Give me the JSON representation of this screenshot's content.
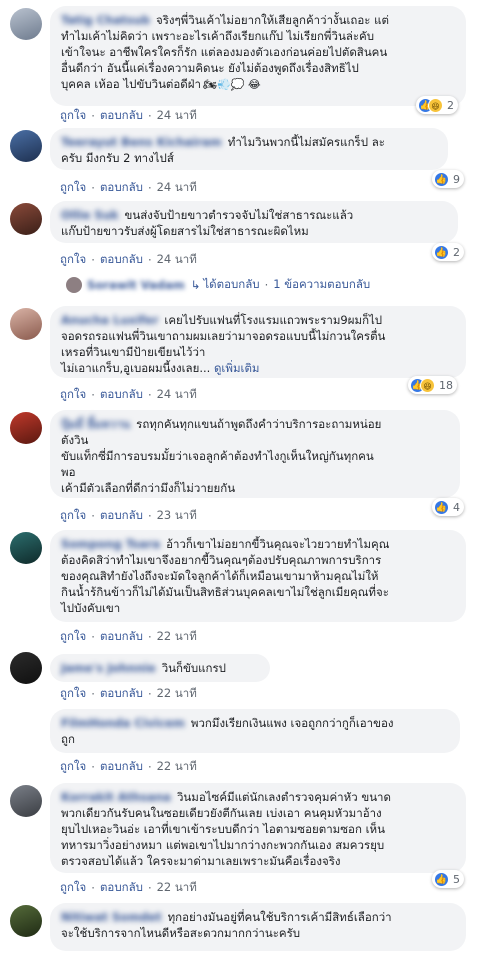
{
  "actions": {
    "like": "ถูกใจ",
    "reply": "ตอบกลับ"
  },
  "comments": [
    {
      "name": "Tatig Chatsub",
      "text": "จริงๆพี่วินเค้าไม่อยากให้เสียลูกค้าว่างั้นเถอะ แต่\nทำไมเค้าไม่คิดว่า เพราะอะไรเค้าถึงเรียกแก๊ป ไม่เรียกพี่วินล่ะคับ\nเข้าใจนะ อาชีพใครใครก็รัก แต่ลองมองตัวเองก่อนค่อยไปตัดสินคน\nอื่นดีกว่า อันนี้แค่เรื่องความคิดนะ ยังไม่ต้องพูดถึงเรื่องสิทธิไป\nบุคคล เห้ออ ไปขับวินต่อดีฝ่า",
      "emoji": "🏍💨💭 😂",
      "time": "24 นาที",
      "reaction_count": "2",
      "reactions": [
        "like",
        "haha"
      ]
    },
    {
      "name": "Teerayut Bens Kichairam",
      "text": "ทำไมวินพวกนี้ไม่สมัครแกร็ป ละ\nครับ มีงกรับ 2 ทางไปส์",
      "time": "24 นาที",
      "reaction_count": "9",
      "reactions": [
        "like"
      ]
    },
    {
      "name": "Ollie Suk",
      "text": "ขนส่งจับป้ายขาวตำรวจจับไม่ใช่สาธารณะแล้ว\nแก๊บป้ายขาวรับส่งผู้โดยสารไม่ใช่สาธารณะผิดไหม",
      "time": "24 นาที",
      "reaction_count": "2",
      "reactions": [
        "like"
      ],
      "reply_summary": {
        "name": "Sorawit Vadam",
        "replied": "ได้ตอบกลับ",
        "count": "1 ข้อความตอบกลับ"
      }
    },
    {
      "name": "Anucha Luxifer",
      "text": "เคยไปรับแฟนที่โรงแรมแถวพระราม9ผมก็ไป\nจอดรถรอแฟนพี่วินเขาถามผมเลยว่ามาจอดรอแบบนี้ไม่กวนใครตื่น\nเหรอที่วินเขามีป้ายเขียนไว้ว่า\nไม่เอาแกร็บ,อูเบอผมนี้งงเลย... ",
      "see_more": "ดูเพิ่มเติม",
      "time": "24 นาที",
      "reaction_count": "18",
      "reactions": [
        "like",
        "haha"
      ]
    },
    {
      "name": "ปุ้มมี่ ยิ้มหวาน",
      "text": "รถทุกคันทุกแขนถ้าพูดถึงคำว่าบริการอะถามหน่อย\nตังวิน\nขับแท็กซี่มีการอบรมมั้ยว่าเจอลูกค้าต้องทำไงกูเห็นใหญ่กันทุกคน\nพอ\nเค้ามีตัวเลือกที่ดีกว่ามึงก็ไม่วายยกัน",
      "time": "23 นาที",
      "reaction_count": "4",
      "reactions": [
        "like"
      ]
    },
    {
      "name": "Sompong Tsara",
      "text": "อ้าวก็เขาไม่อยากขี้วินคุณจะไวยวายทำไมคุณ\nต้องคิดสิว่าทำไมเขาจึงอยากขี้วินคุณๆต้องปรับคุณภาพการบริการ\nของคุณสิทำยังไงถึงจะมัดใจลูกค้าได้ก็เหมือนเขามาห้ามคุณไม่ให้\nกินน้ำร้กินข้าวก็ไม่ได้มันเป็นสิทธิส่วนบุคคลเขาไม่ใช่ลูกเมียคุณที่จะ\nไปบังคับเขา",
      "time": "22 นาที"
    },
    {
      "name": "Jame's Johnnie",
      "text": "วินก็ขับแกรป",
      "time": "22 นาที"
    },
    {
      "name": "FilmHonda Civicem",
      "text": "พวกมึงเรียกเงินแพง เจอถูกกว่ากูก็เอาของ\nถูก",
      "time": "22 นาที"
    },
    {
      "name": "Korrakit Athsana",
      "text": "วินมอไซค์มีแต่นักเลงตำรวจคุมค่าหัว ขนาด\nพวกเดียวกันรับคนในซอยเดียวยังตีกันเลย เบ่งเอา คนคุมหัวมาอ้าง\nยุบไปเหอะวินอ่ะ เอาที่เขาเข้าระบบดีกว่า ไอตามซอยตามซอก เห็น\nทหารมาวิ่งอย่างหมา แต่พอเขาไปมากว่างกะพวกกันเอง สมควรยุบ\nตรวจสอบได้แล้ว ใครจะมาด่ามาเลยเพราะมันคือเรื่องจริง",
      "time": "22 นาที",
      "reaction_count": "5",
      "reactions": [
        "like"
      ]
    },
    {
      "name": "Nitiwat Somdet",
      "text": "ทุกอย่างมันอยู่ที่คนใช้บริการเค้ามีสิทธ์เลือกว่า\nจะใช้บริการจากไหนดีหรือสะดวกมากกว่านะครับ"
    }
  ],
  "colors": {
    "bubble": "#f2f3f5",
    "link": "#385898",
    "meta": "#606770",
    "like": "#3578e5",
    "haha": "#f7c33a"
  }
}
